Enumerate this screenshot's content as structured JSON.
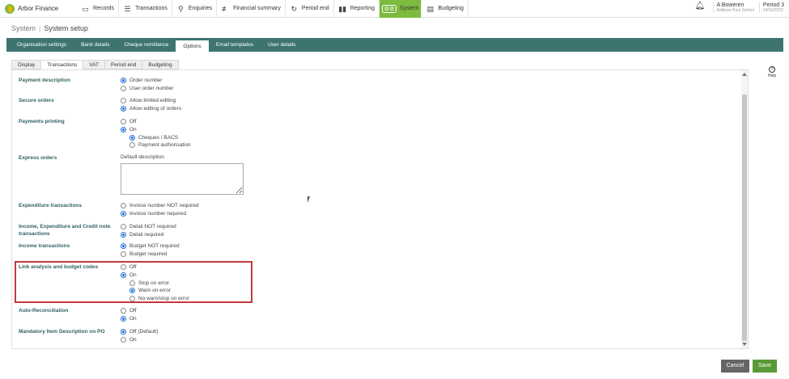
{
  "app": {
    "name": "Arbor Finance"
  },
  "nav": {
    "items": [
      {
        "label": "Records",
        "icon": "records-icon",
        "glyph": "▭"
      },
      {
        "label": "Transactions",
        "icon": "transactions-icon",
        "glyph": "☰"
      },
      {
        "label": "Enquiries",
        "icon": "search-icon",
        "glyph": "⚲"
      },
      {
        "label": "Financial summary",
        "icon": "summary-icon",
        "glyph": "≢"
      },
      {
        "label": "Period end",
        "icon": "period-end-icon",
        "glyph": "↻"
      },
      {
        "label": "Reporting",
        "icon": "reporting-icon",
        "glyph": "▮▮"
      },
      {
        "label": "System",
        "icon": "system-icon",
        "glyph": "⚙⚙",
        "active": true
      },
      {
        "label": "Budgeting",
        "icon": "budgeting-icon",
        "glyph": "▤"
      }
    ]
  },
  "user": {
    "name": "A Boweren",
    "subtitle": "Addison Park School",
    "period_label": "Period 3",
    "period_date": "24/10/2022"
  },
  "breadcrumb": {
    "root": "System",
    "current": "System setup"
  },
  "main_tabs": [
    "Organisation settings",
    "Bank details",
    "Cheque remittance",
    "Options",
    "Email templates",
    "User details"
  ],
  "main_tabs_active": "Options",
  "sub_tabs": [
    "Display",
    "Transactions",
    "VAT",
    "Period end",
    "Budgeting"
  ],
  "sub_tabs_active": "Transactions",
  "settings": {
    "payment_description": {
      "label": "Payment description",
      "options": [
        {
          "text": "Order number",
          "selected": true
        },
        {
          "text": "User order number",
          "selected": false
        }
      ]
    },
    "secure_orders": {
      "label": "Secure orders",
      "options": [
        {
          "text": "Allow limited editing",
          "selected": false
        },
        {
          "text": "Allow editing of orders",
          "selected": true
        }
      ]
    },
    "payments_printing": {
      "label": "Payments printing",
      "options": [
        {
          "text": "Off",
          "selected": false
        },
        {
          "text": "On",
          "selected": true
        }
      ],
      "sub_options": [
        {
          "text": "Cheques / BACS",
          "selected": true
        },
        {
          "text": "Payment authorisation",
          "selected": false
        }
      ]
    },
    "express_orders": {
      "label": "Express orders",
      "field_label": "Default description",
      "value": ""
    },
    "expenditure_transactions": {
      "label": "Expenditure transactions",
      "options": [
        {
          "text": "Invoice number NOT required",
          "selected": false
        },
        {
          "text": "Invoice number required",
          "selected": true
        }
      ]
    },
    "income_expenditure_credit": {
      "label": "Income, Expenditure and Credit note transactions",
      "options": [
        {
          "text": "Detail NOT required",
          "selected": false
        },
        {
          "text": "Detail required",
          "selected": true
        }
      ]
    },
    "income_transactions": {
      "label": "Income transactions",
      "options": [
        {
          "text": "Budget NOT required",
          "selected": true
        },
        {
          "text": "Budget required",
          "selected": false
        }
      ]
    },
    "link_analysis": {
      "label": "Link analysis and budget codes",
      "options": [
        {
          "text": "Off",
          "selected": false
        },
        {
          "text": "On",
          "selected": true
        }
      ],
      "sub_options": [
        {
          "text": "Stop on error",
          "selected": false
        },
        {
          "text": "Warn on error",
          "selected": true
        },
        {
          "text": "No warn/stop on error",
          "selected": false
        }
      ]
    },
    "auto_reconciliation": {
      "label": "Auto-Reconciliation",
      "options": [
        {
          "text": "Off",
          "selected": false
        },
        {
          "text": "On",
          "selected": true
        }
      ]
    },
    "mandatory_item_description": {
      "label": "Mandatory Item Description on PO",
      "options": [
        {
          "text": "Off (Default)",
          "selected": true
        },
        {
          "text": "On",
          "selected": false
        }
      ]
    }
  },
  "help": {
    "label": "Help"
  },
  "footer": {
    "cancel_label": "Cancel",
    "save_label": "Save"
  },
  "colors": {
    "brand_green": "#7dbb3e",
    "tab_bar": "#3d7470",
    "label_teal": "#2e6360",
    "highlight_red": "#c23a3a",
    "radio_blue": "#1e6fd6",
    "save_green": "#5a9a36",
    "cancel_gray": "#666666"
  }
}
